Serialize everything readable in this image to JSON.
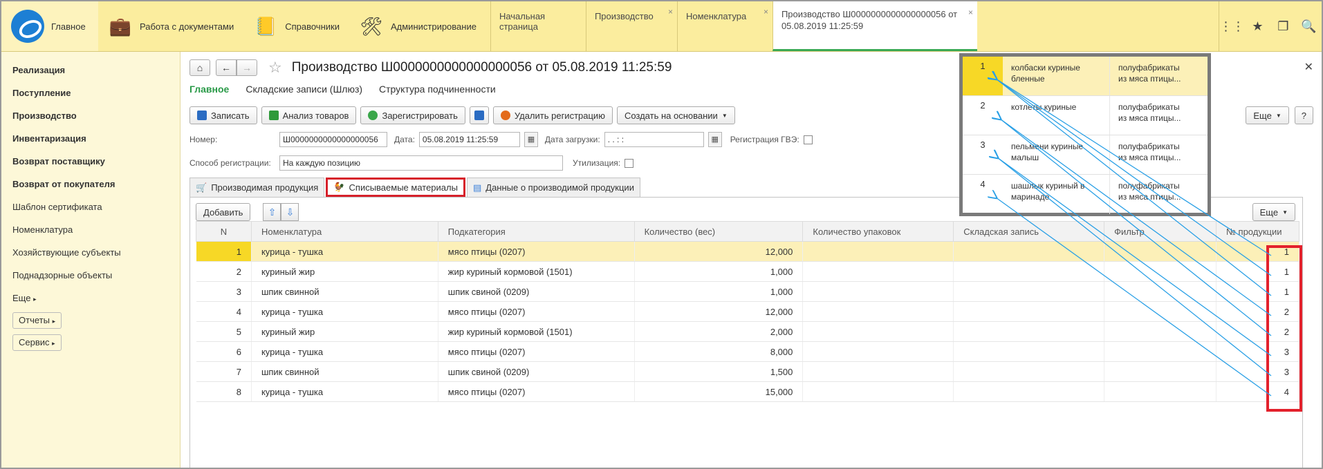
{
  "topnav": {
    "home": "Главное",
    "items": [
      {
        "label": "Работа с документами",
        "icon": "briefcase-icon"
      },
      {
        "label": "Справочники",
        "icon": "notebook-icon"
      },
      {
        "label": "Администрирование",
        "icon": "tools-icon"
      }
    ],
    "tabs": [
      {
        "label": "Начальная страница",
        "close": ""
      },
      {
        "label": "Производство",
        "close": "×"
      },
      {
        "label": "Номенклатура",
        "close": "×"
      },
      {
        "label_line1": "Производство Ш0000000000000000056 от",
        "label_line2": "05.08.2019 11:25:59",
        "close": "×"
      }
    ],
    "right_icons": [
      "grid-icon",
      "star-icon",
      "history-icon",
      "search-icon"
    ]
  },
  "sidebar": {
    "bold_items": [
      "Реализация",
      "Поступление",
      "Производство",
      "Инвентаризация",
      "Возврат поставщику",
      "Возврат от покупателя"
    ],
    "items": [
      "Шаблон сертификата",
      "Номенклатура",
      "Хозяйствующие субъекты",
      "Поднадзорные объекты"
    ],
    "more": "Еще",
    "buttons": [
      "Отчеты",
      "Сервис"
    ]
  },
  "document": {
    "title": "Производство Ш0000000000000000056 от 05.08.2019 11:25:59",
    "subnav": [
      "Главное",
      "Складские записи (Шлюз)",
      "Структура подчиненности"
    ],
    "toolbar": {
      "save": "Записать",
      "analyze": "Анализ товаров",
      "register": "Зарегистрировать",
      "delete_reg": "Удалить регистрацию",
      "create_based": "Создать на основании",
      "more": "Еще",
      "help": "?"
    },
    "fields": {
      "number_label": "Номер:",
      "number_value": "Ш0000000000000000056",
      "date_label": "Дата:",
      "date_value": "05.08.2019 11:25:59",
      "load_date_label": "Дата загрузки:",
      "load_date_value": " .  .      :  :",
      "gve_label": "Регистрация ГВЭ:",
      "method_label": "Способ регистрации:",
      "method_value": "На каждую позицию",
      "util_label": "Утилизация:"
    },
    "tabs": [
      "Производимая продукция",
      "Списываемые материалы",
      "Данные о производимой продукции"
    ],
    "panel": {
      "add": "Добавить",
      "more": "Еще"
    }
  },
  "table": {
    "columns": [
      "N",
      "Номенклатура",
      "Подкатегория",
      "Количество (вес)",
      "Количество упаковок",
      "Складская запись",
      "Фильтр",
      "№ продукции"
    ],
    "rows": [
      [
        "1",
        "курица - тушка",
        "мясо птицы (0207)",
        "12,000",
        "1"
      ],
      [
        "2",
        "куриный жир",
        "жир куриный кормовой (1501)",
        "1,000",
        "1"
      ],
      [
        "3",
        "шпик свинной",
        "шпик свиной (0209)",
        "1,000",
        "1"
      ],
      [
        "4",
        "курица - тушка",
        "мясо птицы (0207)",
        "12,000",
        "2"
      ],
      [
        "5",
        "куриный жир",
        "жир куриный кормовой (1501)",
        "2,000",
        "2"
      ],
      [
        "6",
        "курица - тушка",
        "мясо птицы (0207)",
        "8,000",
        "3"
      ],
      [
        "7",
        "шпик свинной",
        "шпик свиной (0209)",
        "1,500",
        "3"
      ],
      [
        "8",
        "курица - тушка",
        "мясо птицы (0207)",
        "15,000",
        "4"
      ]
    ]
  },
  "popup": {
    "rows": [
      {
        "n": "1",
        "name1": "колбаски куриные",
        "name2": "бленные",
        "cat1": "полуфабрикаты",
        "cat2": "из мяса птицы..."
      },
      {
        "n": "2",
        "name1": "котлеты куриные",
        "name2": "",
        "cat1": "полуфабрикаты",
        "cat2": "из мяса птицы..."
      },
      {
        "n": "3",
        "name1": "пельмени куриные",
        "name2": "малыш",
        "cat1": "полуфабрикаты",
        "cat2": "из мяса птицы..."
      },
      {
        "n": "4",
        "name1": "шашлык куриный в",
        "name2": "маринаде",
        "cat1": "полуфабрикаты",
        "cat2": "из мяса птицы..."
      }
    ]
  },
  "colors": {
    "topbar": "#fbed9e",
    "sidebar": "#fdf8d8",
    "accent_green": "#2a9a48",
    "highlight_red": "#e3212c",
    "selected_row": "#fcf0b8",
    "selected_cell": "#f7d826",
    "arrow_blue": "#2aa0e6"
  }
}
